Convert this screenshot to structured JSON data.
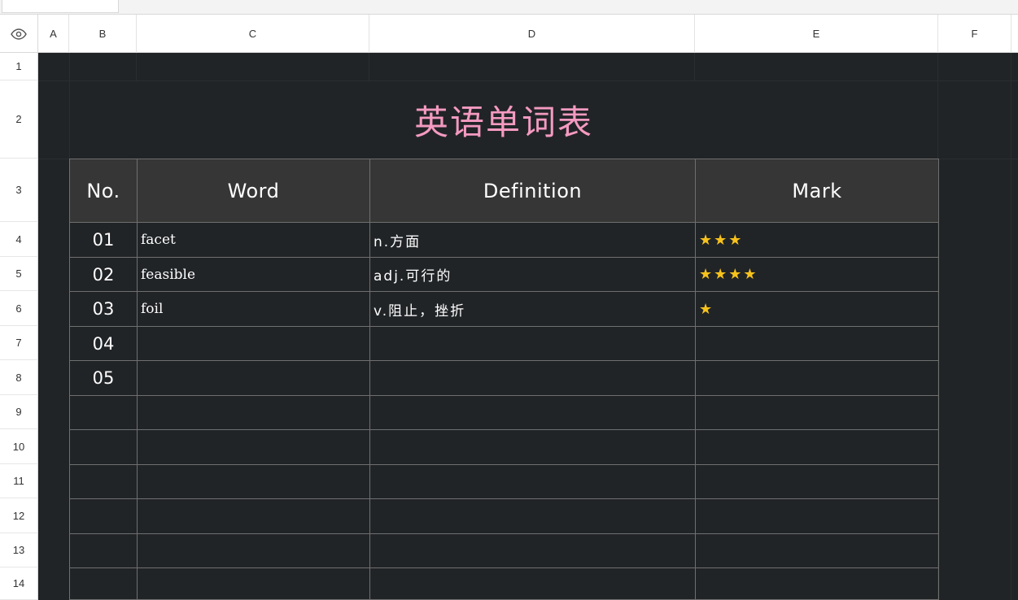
{
  "spreadsheet": {
    "columns": [
      "A",
      "B",
      "C",
      "D",
      "E",
      "F"
    ],
    "rows": [
      "1",
      "2",
      "3",
      "4",
      "5",
      "6",
      "7",
      "8",
      "9",
      "10",
      "11",
      "12",
      "13",
      "14"
    ],
    "title": "英语单词表",
    "table": {
      "headers": [
        "No.",
        "Word",
        "Definition",
        "Mark"
      ],
      "rows": [
        {
          "no": "01",
          "word": "facet",
          "definition": "n.方面",
          "mark": "★★★"
        },
        {
          "no": "02",
          "word": "feasible",
          "definition": "adj.可行的",
          "mark": "★★★★"
        },
        {
          "no": "03",
          "word": "foil",
          "definition": "v.阻止，挫折",
          "mark": "★"
        },
        {
          "no": "04",
          "word": "",
          "definition": "",
          "mark": ""
        },
        {
          "no": "05",
          "word": "",
          "definition": "",
          "mark": ""
        },
        {
          "no": "",
          "word": "",
          "definition": "",
          "mark": ""
        },
        {
          "no": "",
          "word": "",
          "definition": "",
          "mark": ""
        },
        {
          "no": "",
          "word": "",
          "definition": "",
          "mark": ""
        },
        {
          "no": "",
          "word": "",
          "definition": "",
          "mark": ""
        },
        {
          "no": "",
          "word": "",
          "definition": "",
          "mark": ""
        },
        {
          "no": "",
          "word": "",
          "definition": "",
          "mark": ""
        }
      ]
    },
    "colors": {
      "title": "#f49ac1",
      "sheet_bg": "#212427",
      "header_bg": "#363636",
      "star": "#f7c21b"
    },
    "icons": {
      "corner": "eye-icon"
    }
  }
}
